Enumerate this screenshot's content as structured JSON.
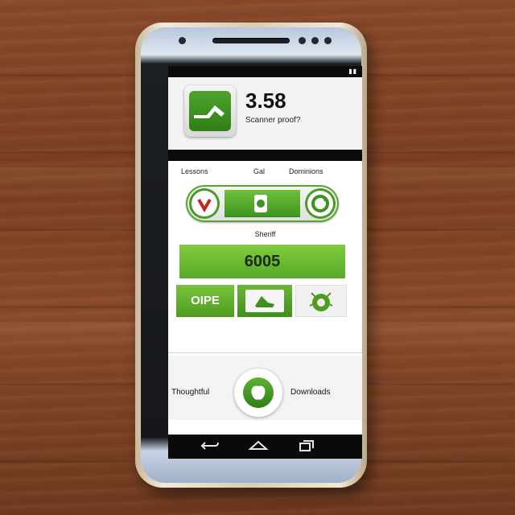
{
  "app": {
    "score": "3.58",
    "subtitle": "Scanner proof?"
  },
  "labels": {
    "left": "Lessons",
    "center": "Gal",
    "right": "Dominions"
  },
  "middle_label": "Sheriff",
  "primary_button": {
    "label": "6005"
  },
  "tiles": {
    "first_label": "OIPE"
  },
  "bottom": {
    "left_label": "Thoughtful",
    "right_label": "Downloads"
  },
  "colors": {
    "accent_green": "#5aa82a",
    "dark_green": "#2f7e18",
    "bar_black": "#0b0b0b"
  },
  "icons": [
    "app-logo-icon",
    "record-icon",
    "leaf-icon",
    "refresh-icon",
    "rabbit-icon",
    "bug-icon",
    "apple-icon",
    "back-icon",
    "home-icon",
    "recent-apps-icon"
  ]
}
